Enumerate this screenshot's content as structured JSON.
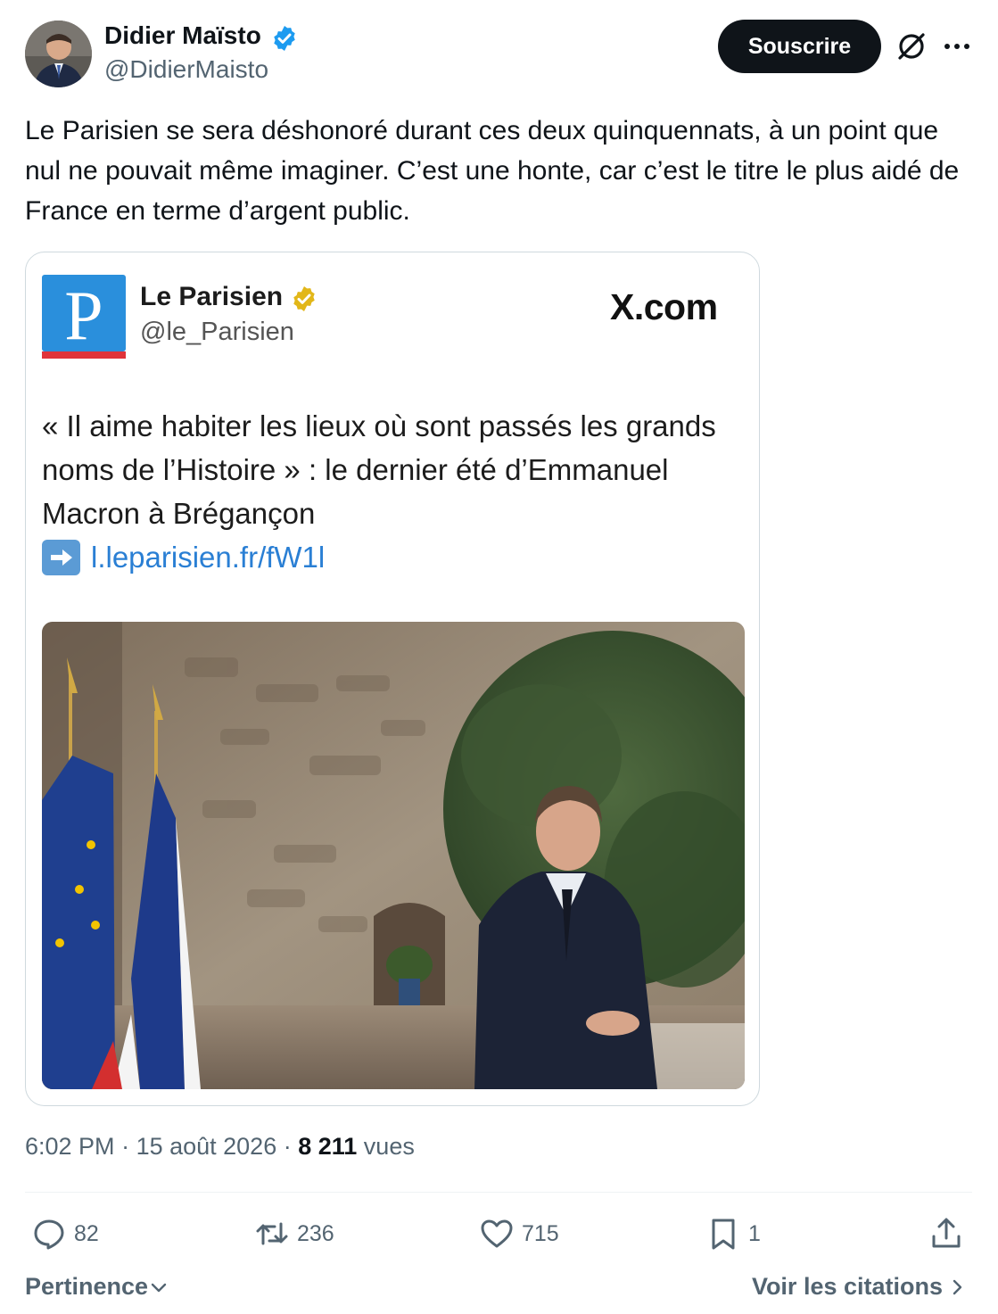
{
  "author": {
    "name": "Didier Maïsto",
    "handle": "@DidierMaisto",
    "verified_color": "#1d9bf0"
  },
  "header": {
    "subscribe_label": "Souscrire",
    "grok_icon": "grok-icon",
    "more_icon": "more-dots-icon"
  },
  "tweet": {
    "text": "Le Parisien se sera déshonoré durant ces deux quinquennats, à un point que nul ne pouvait même imaginer. C’est une honte, car c’est le titre le plus aidé de France en terme d’argent public."
  },
  "quoted": {
    "logo_letter": "P",
    "name": "Le Parisien",
    "handle": "@le_Parisien",
    "site": "X.com",
    "text": "« Il aime habiter les lieux où sont passés les grands noms de l’Histoire » : le dernier été d’Emmanuel Macron à Brégançon",
    "link": "l.leparisien.fr/fW1l",
    "badge_color": "#e2b719",
    "logo_color": "#2a8fdc"
  },
  "meta": {
    "time": "6:02 PM",
    "sep1": " · ",
    "date": "15 août 2026",
    "sep2": " · ",
    "views_count": "8 211",
    "views_label": " vues"
  },
  "actions": {
    "replies": "82",
    "reposts": "236",
    "likes": "715",
    "bookmarks": "1"
  },
  "footer": {
    "sort_label": "Pertinence",
    "quotes_label": "Voir les citations"
  }
}
